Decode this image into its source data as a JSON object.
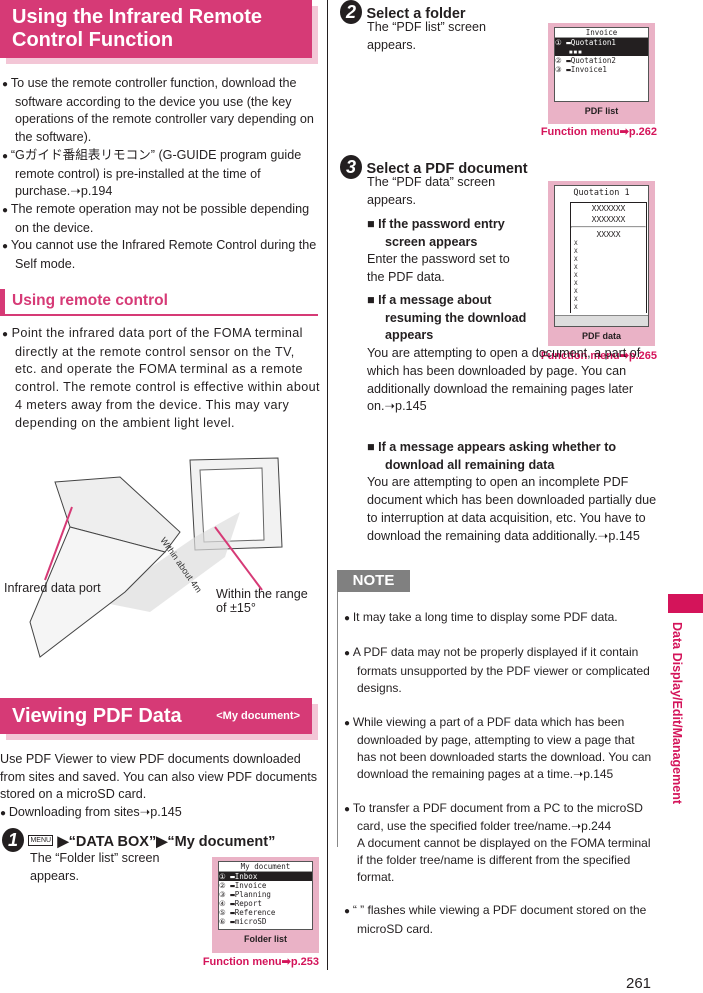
{
  "sec1": {
    "title": "Using the Infrared Remote Control Function",
    "bullets": [
      "To use the remote controller function, download the software according to the device you use (the key operations of the remote controller vary depending on the software).",
      "“Gガイド番組表リモコン” (G-GUIDE program guide remote control) is pre-installed at the time of purchase.➝p.194",
      "The remote operation may not be possible depending on the device.",
      "You cannot use the Infrared Remote Control during the Self mode."
    ]
  },
  "sec2": {
    "title": "Using remote control",
    "bullets": [
      "Point the infrared data port of the FOMA terminal directly at the remote control sensor on the TV, etc. and operate the FOMA terminal as a remote control. The remote control is effective within about 4 meters away from the device. This may vary depending on the ambient light level."
    ]
  },
  "illustration": {
    "port_label": "Infrared data port",
    "range_label": "Within the range of ±15°",
    "distance_label": "Within about 4m"
  },
  "sec3": {
    "title": "Viewing PDF Data",
    "tag": "<My document>",
    "intro": "Use PDF Viewer to view PDF documents downloaded from sites and saved. You can also view PDF documents stored on a microSD card.",
    "bullets": [
      "Downloading from sites➝p.145"
    ]
  },
  "steps": [
    {
      "num": "1",
      "title": "▶“DATA BOX”▶“My document”",
      "key": "MENU",
      "desc": "The “Folder list” screen appears.",
      "screen": {
        "title": "My document",
        "items": [
          "Inbox",
          "Invoice",
          "Planning",
          "Report",
          "Reference",
          "microSD"
        ],
        "caption": "Folder list",
        "fm": "Function menu➡p.253"
      }
    },
    {
      "num": "2",
      "title": "Select a folder",
      "desc": "The “PDF list” screen appears.",
      "screen": {
        "title": "Invoice",
        "items": [
          "Quotation1",
          "Quotation2",
          "Invoice1"
        ],
        "caption": "PDF list",
        "fm": "Function menu➡p.262"
      }
    },
    {
      "num": "3",
      "title": "Select a PDF document",
      "desc": "The “PDF data” screen appears.",
      "screen": {
        "title": "Quotation 1",
        "caption": "PDF data",
        "fm": "Function menu➡p.265"
      },
      "subs": [
        {
          "h": "If the password entry screen appears",
          "t": "Enter the password set to the PDF data."
        },
        {
          "h": "If a message about resuming the download appears",
          "t": "You are attempting to open a document, a part of which has been downloaded by page. You can additionally download the remaining pages later on.➝p.145"
        },
        {
          "h": "If a message appears asking whether to download all remaining data",
          "t": "You are attempting to open an incomplete PDF document which has been downloaded partially due to interruption at data acquisition, etc. You have to download the remaining data additionally.➝p.145"
        }
      ]
    }
  ],
  "note": {
    "label": "NOTE",
    "bullets": [
      "It may take a long time to display some PDF data.",
      "A PDF data may not be properly displayed if it contain formats unsupported by the PDF viewer or complicated designs.",
      "While viewing a part of a PDF data which has been downloaded by page, attempting to view a page that has not been downloaded starts the download. You can download the remaining pages at a time.➝p.145",
      "To transfer a PDF document from a PC to the microSD card, use the specified folder tree/name.➝p.244\nA document cannot be displayed on the FOMA terminal if the folder tree/name is different from the specified format.",
      "“ ” flashes while viewing a PDF document stored on the microSD card."
    ]
  },
  "side_tab": "Data Display/Edit/Management",
  "page_number": "261",
  "colors": {
    "accent": "#d63a76",
    "tab": "#d4145a"
  }
}
